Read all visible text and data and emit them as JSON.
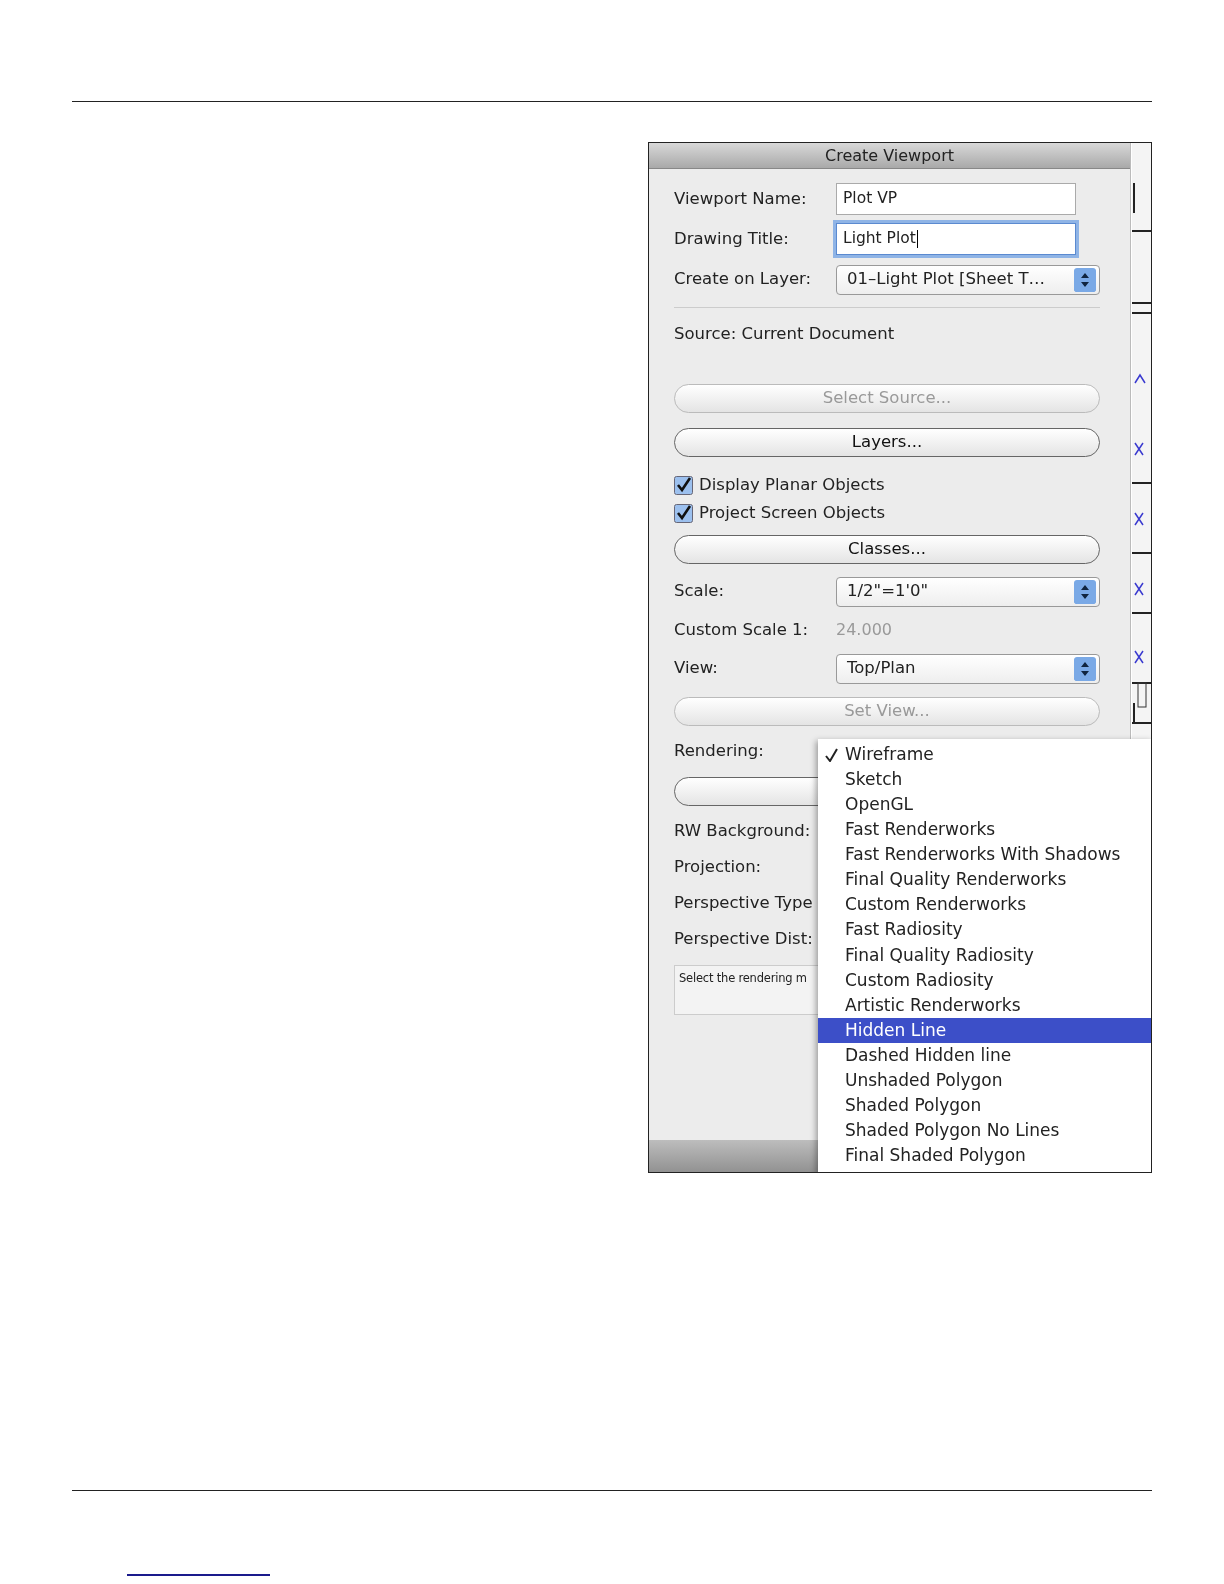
{
  "dialog": {
    "title": "Create Viewport",
    "rows": [
      {
        "kind": "text",
        "label": "Viewport Name:",
        "value": "Plot VP",
        "focused": false
      },
      {
        "kind": "text",
        "label": "Drawing Title:",
        "value": "Light Plot",
        "focused": true
      },
      {
        "kind": "select",
        "label": "Create on Layer:",
        "value": "01–Light Plot [Sheet T…"
      },
      {
        "kind": "divider"
      },
      {
        "kind": "info",
        "label": "Source:",
        "value": "Current Document"
      },
      {
        "kind": "button",
        "label": "Select Source...",
        "disabled": true
      },
      {
        "kind": "button",
        "label": "Layers...",
        "disabled": false
      },
      {
        "kind": "checkbox",
        "label": "Display Planar Objects",
        "checked": true
      },
      {
        "kind": "checkbox",
        "label": "Project Screen Objects",
        "checked": true
      },
      {
        "kind": "button",
        "label": "Classes...",
        "disabled": false
      },
      {
        "kind": "select",
        "label": "Scale:",
        "value": "1/2\"=1'0\""
      },
      {
        "kind": "static",
        "label": "Custom Scale 1:",
        "value": "24.000",
        "disabled": true
      },
      {
        "kind": "select",
        "label": "View:",
        "value": "Top/Plan"
      },
      {
        "kind": "button",
        "label": "Set View...",
        "disabled": true
      },
      {
        "kind": "label",
        "label": "Rendering:"
      },
      {
        "kind": "button",
        "disabled": false
      },
      {
        "kind": "label",
        "label": "RW Background:"
      },
      {
        "kind": "label",
        "label": "Projection:"
      },
      {
        "kind": "label",
        "label": "Perspective Type"
      },
      {
        "kind": "label",
        "label": "Perspective Dist:"
      },
      {
        "kind": "help",
        "label": "Select the rendering m"
      }
    ],
    "menu": [
      {
        "label": "Wireframe",
        "checked": true,
        "selected": false
      },
      {
        "label": "Sketch",
        "checked": false,
        "selected": false
      },
      {
        "label": "OpenGL",
        "checked": false,
        "selected": false
      },
      {
        "label": "Fast Renderworks",
        "checked": false,
        "selected": false
      },
      {
        "label": "Fast Renderworks With Shadows",
        "checked": false,
        "selected": false
      },
      {
        "label": "Final Quality Renderworks",
        "checked": false,
        "selected": false
      },
      {
        "label": "Custom Renderworks",
        "checked": false,
        "selected": false
      },
      {
        "label": "Fast Radiosity",
        "checked": false,
        "selected": false
      },
      {
        "label": "Final Quality Radiosity",
        "checked": false,
        "selected": false
      },
      {
        "label": "Custom Radiosity",
        "checked": false,
        "selected": false
      },
      {
        "label": "Artistic Renderworks",
        "checked": false,
        "selected": false
      },
      {
        "label": "Hidden Line",
        "checked": false,
        "selected": true
      },
      {
        "label": "Dashed Hidden line",
        "checked": false,
        "selected": false
      },
      {
        "label": "Unshaded Polygon",
        "checked": false,
        "selected": false
      },
      {
        "label": "Shaded Polygon",
        "checked": false,
        "selected": false
      },
      {
        "label": "Shaded Polygon No Lines",
        "checked": false,
        "selected": false
      },
      {
        "label": "Final Shaded Polygon",
        "checked": false,
        "selected": false
      }
    ]
  }
}
